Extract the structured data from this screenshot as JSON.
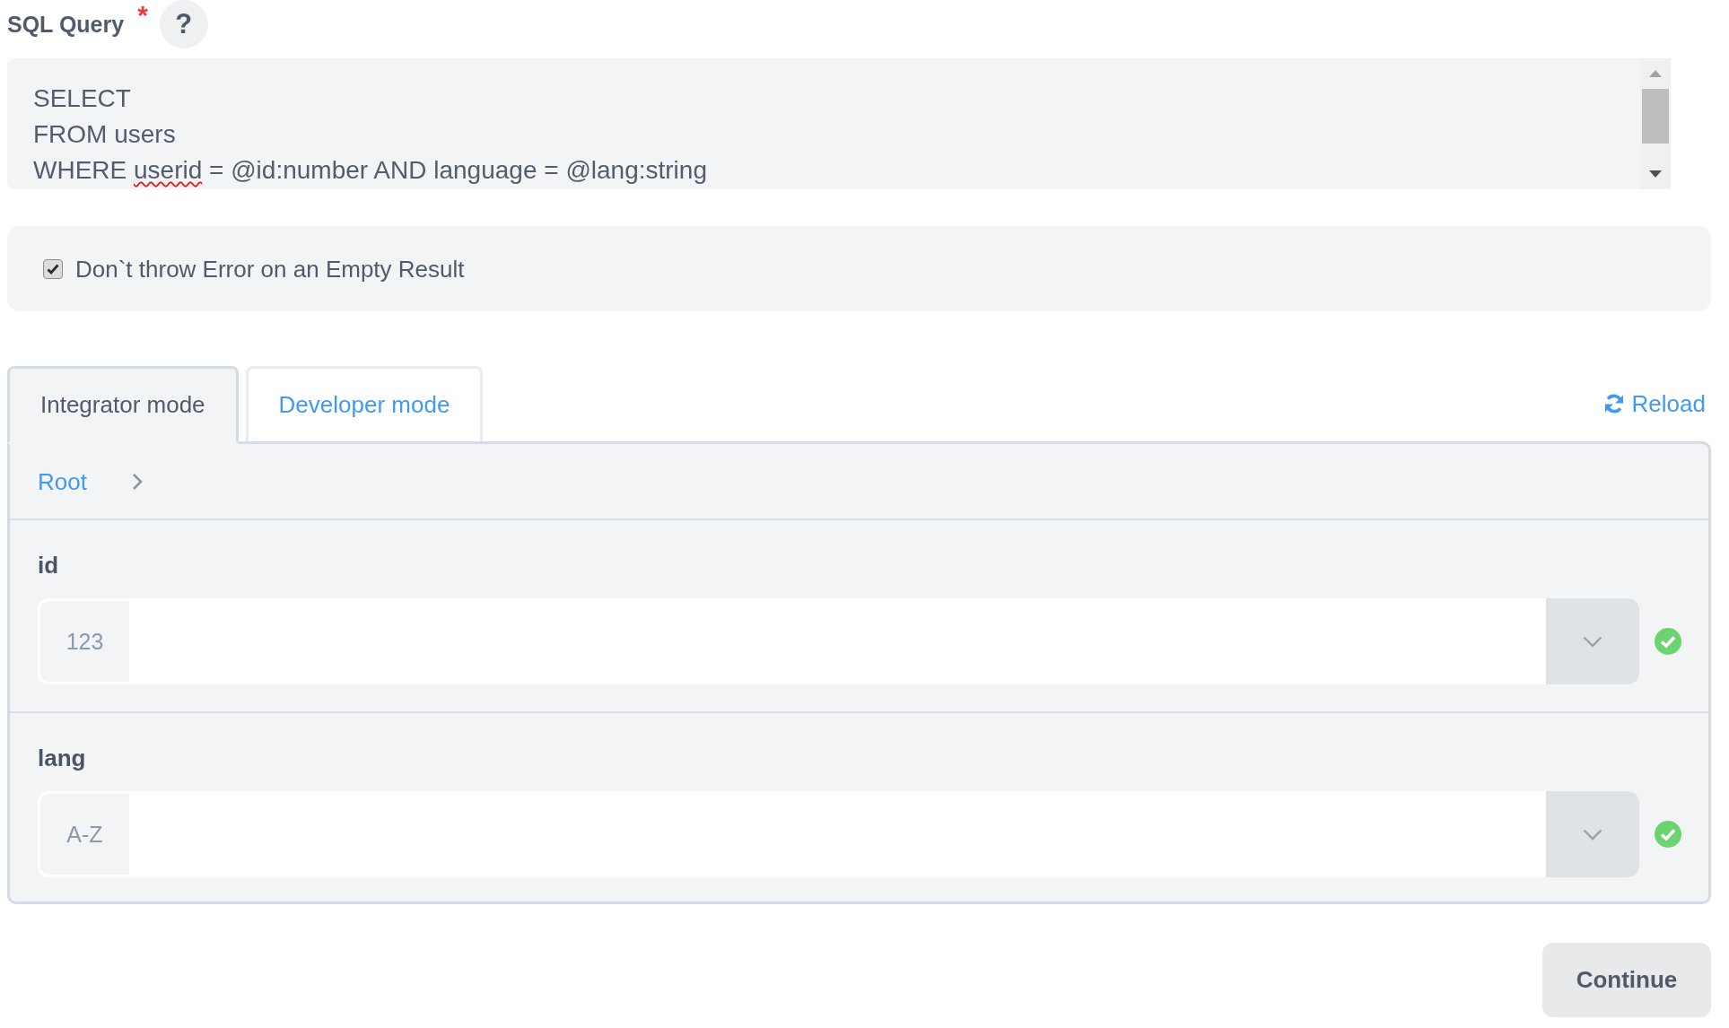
{
  "sql_query": {
    "label": "SQL Query",
    "required_mark": "*",
    "help": "?",
    "lines": [
      [
        {
          "text": "SELECT",
          "misspelled": false
        }
      ],
      [
        {
          "text": "FROM users",
          "misspelled": false
        }
      ],
      [
        {
          "text": "WHERE ",
          "misspelled": false
        },
        {
          "text": "userid",
          "misspelled": true
        },
        {
          "text": " = @id:number AND language = @lang:string",
          "misspelled": false
        }
      ]
    ]
  },
  "empty_result_option": {
    "label": "Don`t throw Error on an Empty Result",
    "checked": true
  },
  "tabs": [
    {
      "label": "Integrator mode",
      "selected": true
    },
    {
      "label": "Developer mode",
      "selected": false
    }
  ],
  "reload": {
    "label": "Reload"
  },
  "breadcrumb": [
    {
      "label": "Root"
    }
  ],
  "parameters": [
    {
      "name": "id",
      "type_prefix": "123",
      "valid": true
    },
    {
      "name": "lang",
      "type_prefix": "A-Z",
      "valid": true
    }
  ],
  "continue_button": {
    "label": "Continue"
  }
}
